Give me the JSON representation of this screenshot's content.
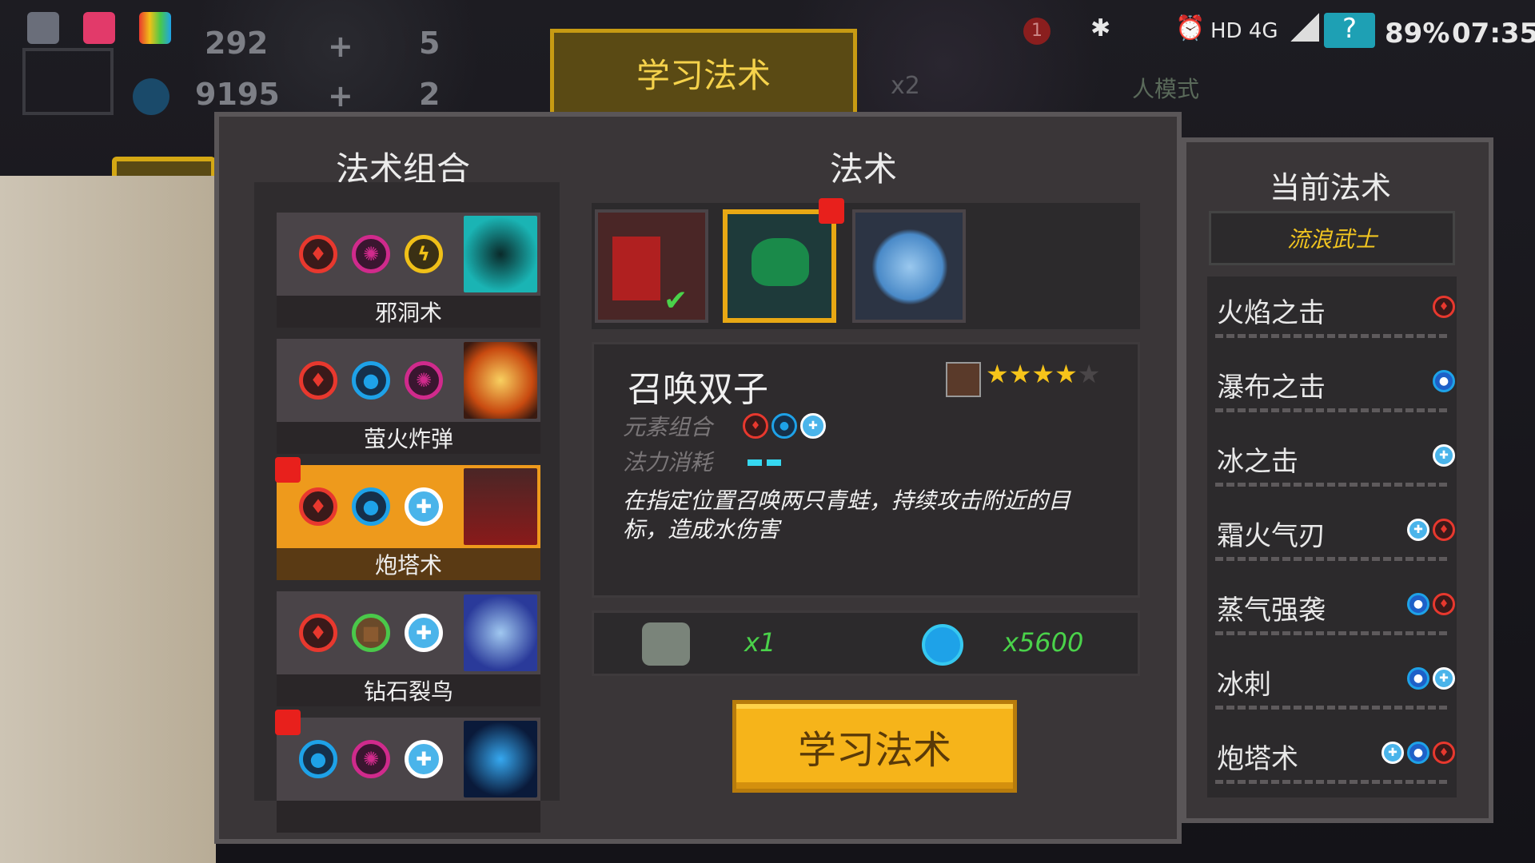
{
  "status_bar": {
    "network": "HD 4G",
    "battery": "89%",
    "time": "07:35"
  },
  "counters": {
    "gems": "292",
    "coins": "9195",
    "item_a": "5",
    "item_b": "2",
    "mode_hint": "人模式",
    "multiplier": "x2",
    "notification_badge": "1"
  },
  "header": {
    "title": "学习法术"
  },
  "combos_panel": {
    "title": "法术组合",
    "combos": [
      {
        "name": "邪洞术",
        "elements": [
          "fire",
          "arcane",
          "bolt"
        ],
        "active": false,
        "new": false
      },
      {
        "name": "萤火炸弹",
        "elements": [
          "fire",
          "water",
          "arcane"
        ],
        "active": false,
        "new": false
      },
      {
        "name": "炮塔术",
        "elements": [
          "fire",
          "water",
          "ice"
        ],
        "active": true,
        "new": true
      },
      {
        "name": "钻石裂鸟",
        "elements": [
          "fire",
          "earth",
          "ice"
        ],
        "active": false,
        "new": false
      },
      {
        "name": "",
        "elements": [
          "water",
          "arcane",
          "ice"
        ],
        "active": false,
        "new": true
      }
    ]
  },
  "spells_panel": {
    "title": "法术",
    "detail": {
      "name": "召唤双子",
      "stars": 4,
      "max_stars": 5,
      "elements_label": "元素组合",
      "mana_label": "法力消耗",
      "description": "在指定位置召唤两只青蛙，持续攻击附近的目标，造成水伤害"
    },
    "cost": {
      "material_qty": "x1",
      "gem_qty": "x5600"
    },
    "learn_button": "学习法术"
  },
  "current_panel": {
    "title": "当前法术",
    "class_name": "流浪武士",
    "spells": [
      {
        "name": "火焰之击",
        "elements": [
          "fire"
        ]
      },
      {
        "name": "瀑布之击",
        "elements": [
          "water"
        ]
      },
      {
        "name": "冰之击",
        "elements": [
          "ice"
        ]
      },
      {
        "name": "霜火气刃",
        "elements": [
          "ice",
          "fire"
        ]
      },
      {
        "name": "蒸气强袭",
        "elements": [
          "water",
          "fire"
        ]
      },
      {
        "name": "冰刺",
        "elements": [
          "water",
          "ice"
        ]
      },
      {
        "name": "炮塔术",
        "elements": [
          "ice",
          "water",
          "fire"
        ]
      }
    ]
  },
  "colors": {
    "accent_gold": "#f6b41a",
    "active_orange": "#ee9a1c",
    "fire": "#e8382e",
    "water": "#1ea2e8",
    "arcane": "#d02a8c",
    "bolt": "#f0c018"
  }
}
